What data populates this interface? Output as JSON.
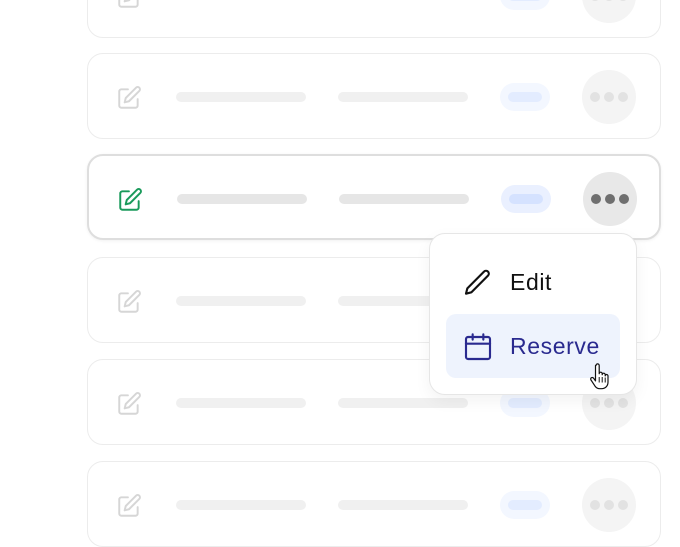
{
  "rows": [
    {
      "id": 0,
      "state": "inactive"
    },
    {
      "id": 1,
      "state": "inactive"
    },
    {
      "id": 2,
      "state": "active"
    },
    {
      "id": 3,
      "state": "inactive"
    },
    {
      "id": 4,
      "state": "inactive"
    },
    {
      "id": 5,
      "state": "inactive"
    }
  ],
  "icons": {
    "row_edit": "square-pencil-icon",
    "more": "ellipsis-icon",
    "menu_edit": "pencil-icon",
    "menu_reserve": "calendar-icon",
    "cursor": "hand-pointer-cursor"
  },
  "menu": {
    "items": [
      {
        "label": "Edit"
      },
      {
        "label": "Reserve"
      }
    ]
  },
  "colors": {
    "active_icon": "#1a9a5b",
    "inactive_icon": "#d6d6d6",
    "reserve_accent": "#2a2a8f",
    "reserve_highlight": "#eef3fd"
  }
}
